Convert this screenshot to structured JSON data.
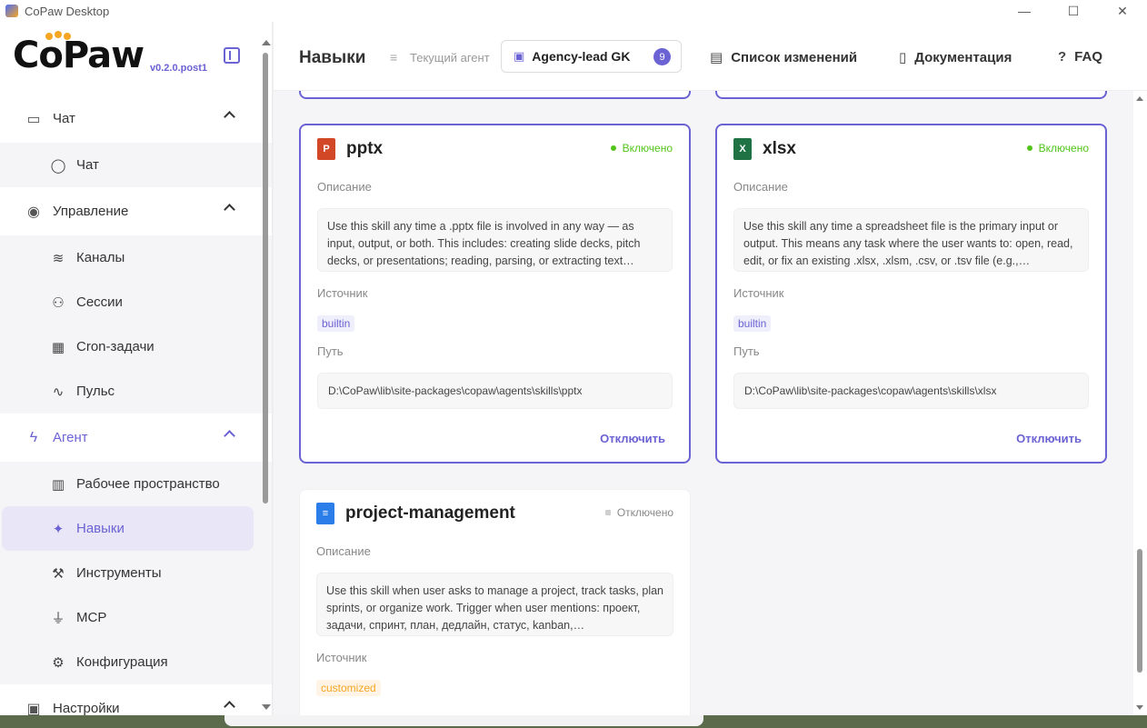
{
  "window": {
    "title": "CoPaw Desktop",
    "controls": {
      "minimize": "—",
      "maximize": "☐",
      "close": "✕"
    }
  },
  "sidebar": {
    "logo": "CoPaw",
    "version": "v0.2.0.post1",
    "groups": [
      {
        "label": "Чат",
        "icon": "chat-square-icon",
        "items": [
          {
            "label": "Чат",
            "icon": "chat-bubble-icon"
          }
        ]
      },
      {
        "label": "Управление",
        "icon": "broadcast-icon",
        "items": [
          {
            "label": "Каналы",
            "icon": "wifi-icon"
          },
          {
            "label": "Сессии",
            "icon": "users-icon"
          },
          {
            "label": "Cron-задачи",
            "icon": "calendar-clock-icon"
          },
          {
            "label": "Пульс",
            "icon": "pulse-icon"
          }
        ]
      },
      {
        "label": "Агент",
        "icon": "lightning-icon",
        "items": [
          {
            "label": "Рабочее пространство",
            "icon": "briefcase-icon"
          },
          {
            "label": "Навыки",
            "icon": "sparkle-icon",
            "selected": true
          },
          {
            "label": "Инструменты",
            "icon": "wrench-icon"
          },
          {
            "label": "MCP",
            "icon": "plug-icon"
          },
          {
            "label": "Конфигурация",
            "icon": "gear-icon"
          }
        ]
      },
      {
        "label": "Настройки",
        "icon": "settings-icon"
      }
    ]
  },
  "header": {
    "title": "Навыки",
    "current_agent_label": "Текущий агент",
    "agent_name": "Agency-lead GK",
    "agent_count": "9",
    "links": {
      "changelog": "Список изменений",
      "docs": "Документация",
      "faq": "FAQ"
    }
  },
  "labels": {
    "description": "Описание",
    "source": "Источник",
    "path": "Путь",
    "enabled": "Включено",
    "disabled": "Отключено",
    "disable_action": "Отключить"
  },
  "skills": [
    {
      "name": "pptx",
      "file_type": "P",
      "status": "Включено",
      "description": "Use this skill any time a .pptx file is involved in any way — as input, output, or both. This includes: creating slide decks, pitch decks, or presentations; reading, parsing, or extracting text…",
      "source": "builtin",
      "path": "D:\\CoPaw\\lib\\site-packages\\copaw\\agents\\skills\\pptx",
      "action": "Отключить"
    },
    {
      "name": "xlsx",
      "file_type": "X",
      "status": "Включено",
      "description": "Use this skill any time a spreadsheet file is the primary input or output. This means any task where the user wants to: open, read, edit, or fix an existing .xlsx, .xlsm, .csv, or .tsv file (e.g.,…",
      "source": "builtin",
      "path": "D:\\CoPaw\\lib\\site-packages\\copaw\\agents\\skills\\xlsx",
      "action": "Отключить"
    },
    {
      "name": "project-management",
      "file_type": "",
      "status": "Отключено",
      "description": "Use this skill when user asks to manage a project, track tasks, plan sprints, or organize work. Trigger when user mentions: проект, задачи, спринт, план, дедлайн, статус, kanban,…",
      "source": "customized"
    }
  ],
  "colors": {
    "accent": "#6b62d4",
    "enabled": "#52c41a",
    "customized": "#f5a623",
    "ppt": "#d24726",
    "xls": "#1f7244",
    "doc": "#2b7de9"
  }
}
